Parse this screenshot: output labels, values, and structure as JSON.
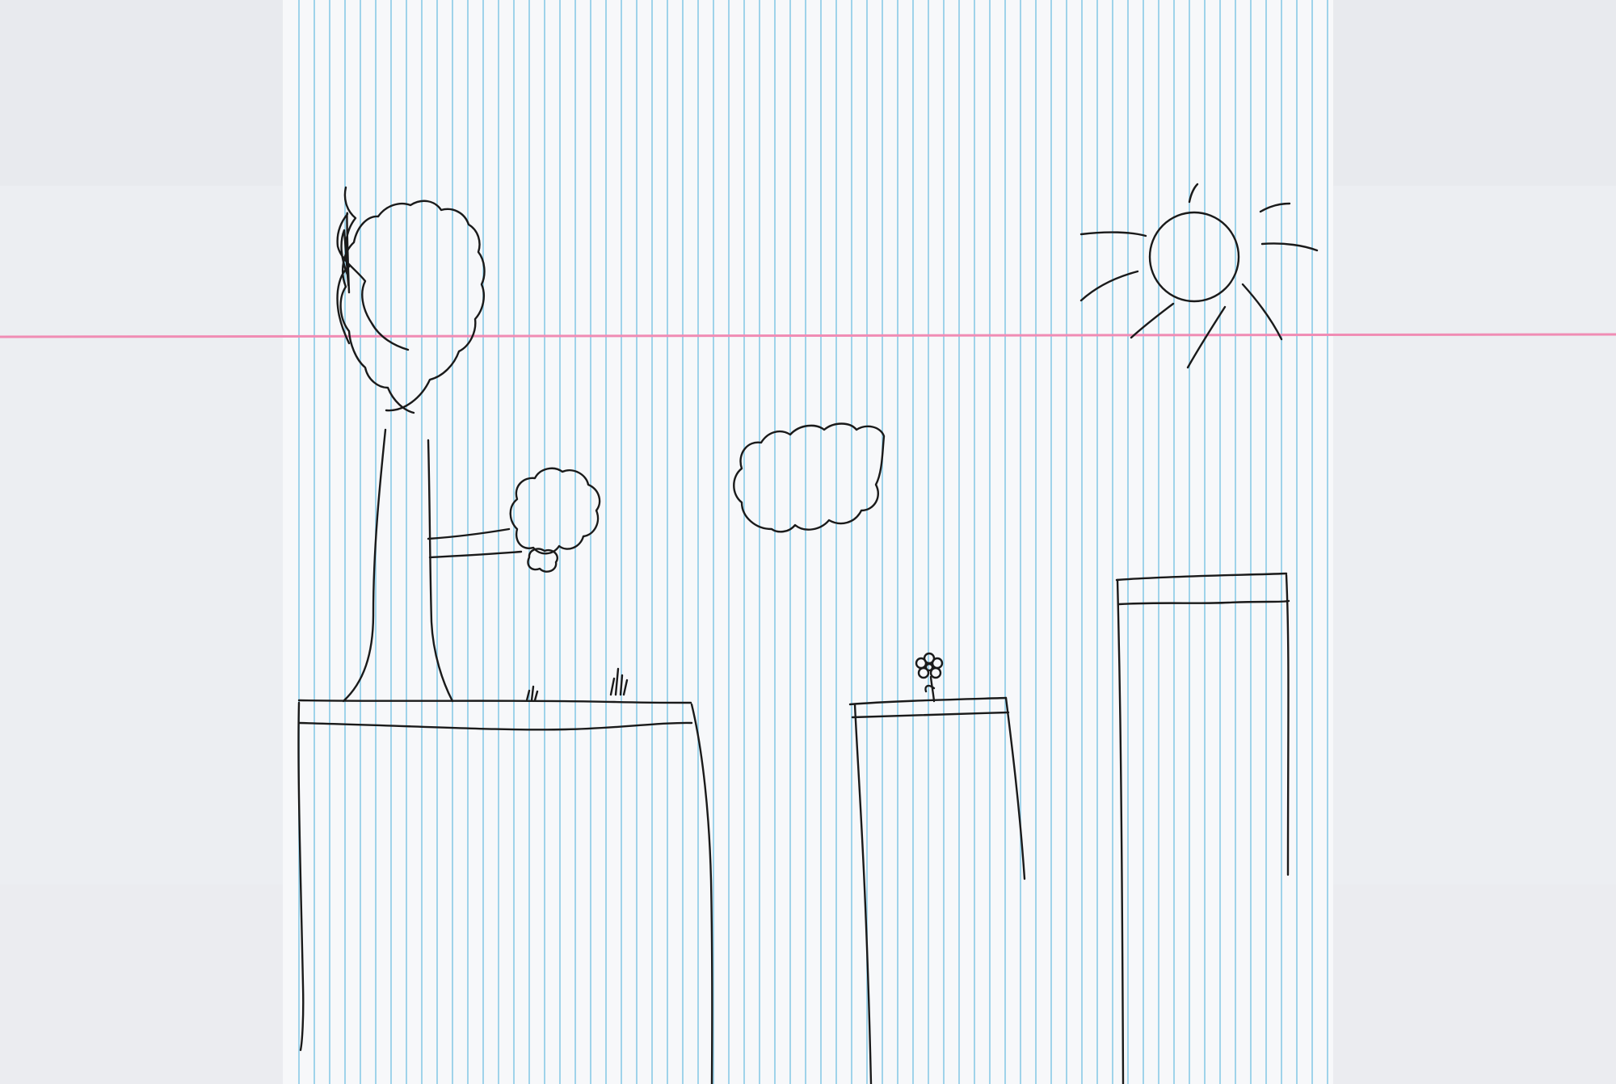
{
  "scene": {
    "title": "",
    "colors": {
      "paper": "#f7f8fa",
      "background": "#eceef2",
      "rule_line": "#9fd3ea",
      "margin_line": "#f08cb4",
      "ink": "#1a1a1a"
    },
    "elements": [
      "tree-sprite",
      "left-cliff-platform",
      "middle-pillar-platform",
      "right-tall-pillar-platform",
      "floating-bush",
      "cloud",
      "sun",
      "flower",
      "grass-tufts"
    ]
  }
}
